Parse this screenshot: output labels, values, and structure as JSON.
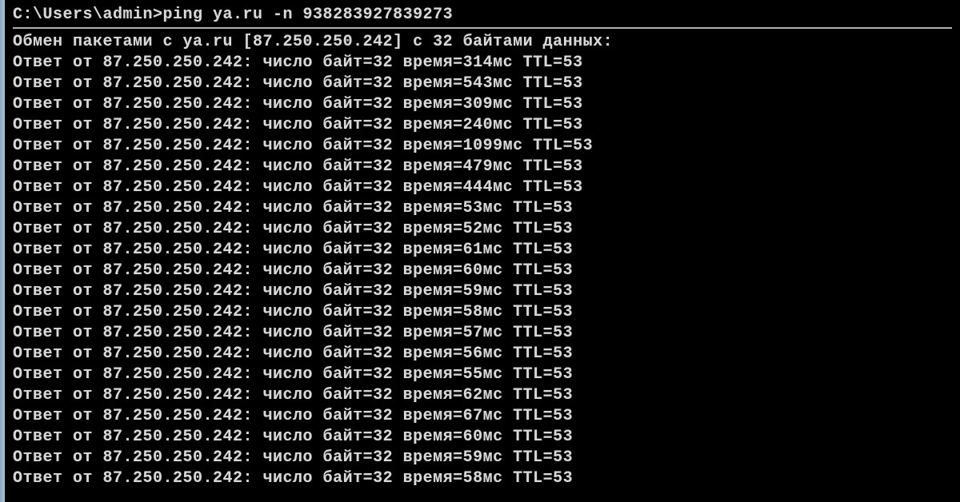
{
  "prompt": "C:\\Users\\admin>ping ya.ru -n 938283927839273",
  "header": "Обмен пакетами с ya.ru [87.250.250.242] с 32 байтами данных:",
  "ip": "87.250.250.242",
  "bytes": 32,
  "ttl": 53,
  "replies": [
    {
      "time": 314
    },
    {
      "time": 543
    },
    {
      "time": 309
    },
    {
      "time": 240
    },
    {
      "time": 1099
    },
    {
      "time": 479
    },
    {
      "time": 444
    },
    {
      "time": 53
    },
    {
      "time": 52
    },
    {
      "time": 61
    },
    {
      "time": 60
    },
    {
      "time": 59
    },
    {
      "time": 58
    },
    {
      "time": 57
    },
    {
      "time": 56
    },
    {
      "time": 55
    },
    {
      "time": 62
    },
    {
      "time": 67
    },
    {
      "time": 60
    },
    {
      "time": 59
    },
    {
      "time": 58
    }
  ],
  "labels": {
    "reply_prefix": "Ответ от",
    "bytes_label": "число байт",
    "time_label": "время",
    "time_unit": "мс",
    "ttl_label": "TTL"
  }
}
